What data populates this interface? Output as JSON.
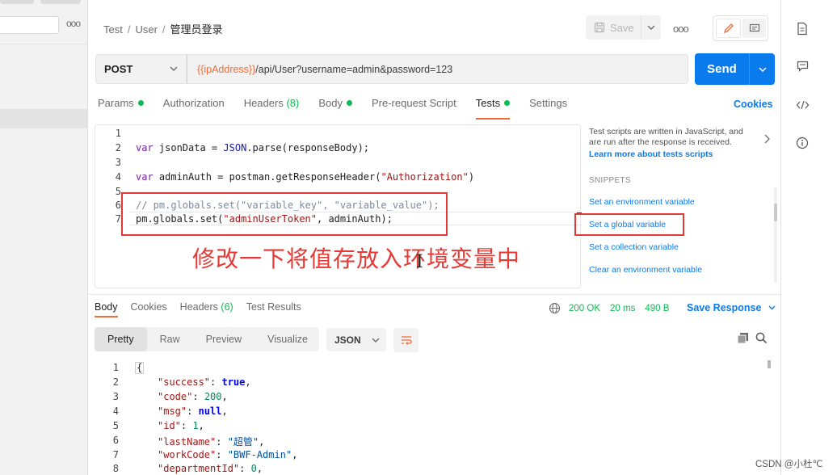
{
  "breadcrumb": {
    "parts": [
      "Test",
      "User"
    ],
    "current": "管理员登录"
  },
  "header": {
    "save_label": "Save",
    "more": "ooo"
  },
  "request": {
    "method": "POST",
    "url_variable": "{{ipAddress}}",
    "url_path": "/api/User?username=admin&password=123",
    "send_label": "Send"
  },
  "request_tabs": {
    "params": "Params",
    "authorization": "Authorization",
    "headers": "Headers",
    "headers_count": "(8)",
    "body": "Body",
    "pre_request": "Pre-request Script",
    "tests": "Tests",
    "settings": "Settings",
    "cookies": "Cookies"
  },
  "editor": {
    "line_numbers": [
      "1",
      "2",
      "3",
      "4",
      "5",
      "6",
      "7"
    ],
    "line2_kw": "var",
    "line2_rest": " jsonData = ",
    "line2_obj": "JSON",
    "line2_fn": ".parse",
    "line2_tail": "(responseBody);",
    "line4_kw": "var",
    "line4_rest": " adminAuth = postman.",
    "line4_fn": "getResponseHeader",
    "line4_open": "(",
    "line4_str": "\"Authorization\"",
    "line4_close": ")",
    "line6_comment": "// pm.globals.set(\"variable_key\", \"variable_value\");",
    "line7_a": "pm.globals.",
    "line7_fn": "set",
    "line7_open": "(",
    "line7_str": "\"adminUserToken\"",
    "line7_tail": ", adminAuth);"
  },
  "annotation": {
    "text": "修改一下将值存放入环境变量中"
  },
  "snippets": {
    "description": "Test scripts are written in JavaScript, and are run after the response is received.",
    "learn_more": "Learn more about tests scripts",
    "title": "SNIPPETS",
    "items": [
      "Set an environment variable",
      "Set a global variable",
      "Set a collection variable",
      "Clear an environment variable"
    ]
  },
  "response_tabs": {
    "body": "Body",
    "cookies": "Cookies",
    "headers": "Headers",
    "headers_count": "(6)",
    "test_results": "Test Results"
  },
  "response_status": {
    "status": "200 OK",
    "time": "20 ms",
    "size": "490 B",
    "save_response": "Save Response"
  },
  "view_tabs": {
    "pretty": "Pretty",
    "raw": "Raw",
    "preview": "Preview",
    "visualize": "Visualize",
    "format": "JSON"
  },
  "response_body": {
    "line_numbers": [
      "1",
      "2",
      "3",
      "4",
      "5",
      "6",
      "7",
      "8"
    ],
    "open_brace": "{",
    "rows": [
      {
        "key": "\"success\"",
        "value": "true",
        "type": "bool"
      },
      {
        "key": "\"code\"",
        "value": "200",
        "type": "num"
      },
      {
        "key": "\"msg\"",
        "value": "null",
        "type": "bool"
      },
      {
        "key": "\"id\"",
        "value": "1",
        "type": "num"
      },
      {
        "key": "\"lastName\"",
        "value": "\"超管\"",
        "type": "str"
      },
      {
        "key": "\"workCode\"",
        "value": "\"BWF-Admin\"",
        "type": "str"
      },
      {
        "key": "\"departmentId\"",
        "value": "0",
        "type": "num"
      }
    ]
  },
  "watermark": "CSDN @小杜℃",
  "colors": {
    "accent": "#097bed",
    "tab_active": "#f26b3a",
    "status_ok": "#0cbb52",
    "annotation": "#e53935"
  }
}
